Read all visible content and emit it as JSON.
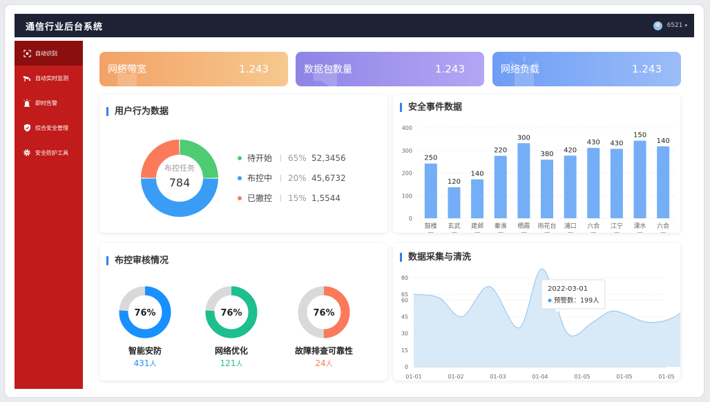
{
  "app": {
    "title": "通信行业后台系统",
    "user": "6521"
  },
  "colors": {
    "topbar": "#1d2235",
    "sidebar": "#c11b1b",
    "sidebar_active": "#8b0f0f",
    "accent": "#2f80ed"
  },
  "sidebar": {
    "items": [
      {
        "label": "自动识别",
        "icon": "scan-icon",
        "active": true
      },
      {
        "label": "自动实时监测",
        "icon": "camera-icon",
        "active": false
      },
      {
        "label": "即时告警",
        "icon": "alarm-light-icon",
        "active": false
      },
      {
        "label": "综合安全管理",
        "icon": "shield-icon",
        "active": false
      },
      {
        "label": "安全防护工具",
        "icon": "gear-icon",
        "active": false
      }
    ]
  },
  "stats": [
    {
      "label": "网络带宽",
      "value": "1.243"
    },
    {
      "label": "数据包数量",
      "value": "1.243"
    },
    {
      "label": "网络负载",
      "value": "1.243"
    }
  ],
  "user_behavior": {
    "title": "用户行为数据",
    "center_label": "布控任务",
    "center_value": "784",
    "legend": [
      {
        "name": "待开始",
        "percent": "65%",
        "value": "52,3456",
        "color": "#4ecb73"
      },
      {
        "name": "布控中",
        "percent": "20%",
        "value": "45,6732",
        "color": "#3a9df5"
      },
      {
        "name": "已撤控",
        "percent": "15%",
        "value": "1,5544",
        "color": "#fb7a5a"
      }
    ]
  },
  "review": {
    "title": "布控审核情况",
    "gauges": [
      {
        "name": "智能安防",
        "percent_label": "76%",
        "percent": 0.76,
        "count": "431",
        "unit": "人",
        "color": "#1890ff"
      },
      {
        "name": "网络优化",
        "percent_label": "76%",
        "percent": 0.76,
        "count": "121",
        "unit": "人",
        "color": "#1dbf8f"
      },
      {
        "name": "故障排查可靠性",
        "percent_label": "76%",
        "percent": 0.5,
        "count": "24",
        "unit": "人",
        "color": "#fb7a5a"
      }
    ]
  },
  "chart_data": [
    {
      "type": "pie",
      "categories": [
        "待开始",
        "布控中",
        "已撤控"
      ],
      "values": [
        25,
        50,
        25
      ],
      "colors": [
        "#4ecb73",
        "#3a9df5",
        "#fb7a5a"
      ],
      "title": "用户行为数据"
    },
    {
      "type": "bar",
      "title": "安全事件数据",
      "categories": [
        [
          "鼓楼",
          "区"
        ],
        [
          "玄武",
          "区"
        ],
        [
          "建邺",
          "区"
        ],
        [
          "秦淮",
          "区"
        ],
        [
          "栖霞",
          "区"
        ],
        [
          "雨花台",
          "区"
        ],
        [
          "浦口",
          "区"
        ],
        [
          "六合",
          "区"
        ],
        [
          "江宁",
          "区"
        ],
        [
          "溧水",
          "区"
        ],
        [
          "六合",
          "区"
        ]
      ],
      "values": [
        250,
        120,
        140,
        220,
        300,
        380,
        420,
        430,
        430,
        150,
        140
      ],
      "heights": [
        242,
        137,
        172,
        276,
        332,
        259,
        277,
        311,
        307,
        343,
        318
      ],
      "ylim": [
        0,
        400
      ],
      "yticks": [
        "0",
        "100",
        "200",
        "300",
        "400"
      ],
      "color": "#74aef7",
      "grid": true
    },
    {
      "type": "area",
      "title": "数据采集与清洗",
      "xticks": [
        "01-01",
        "01-02",
        "01-03",
        "01-04",
        "01-05",
        "01-05",
        "01-05"
      ],
      "x": [
        0,
        0.6,
        1.15,
        1.8,
        2.5,
        3.05,
        3.65,
        4.25,
        4.75,
        5.55,
        6.2,
        6.7
      ],
      "values": [
        65,
        62,
        45,
        72,
        35,
        88,
        30,
        40,
        50,
        40,
        45,
        63
      ],
      "ylim": [
        0,
        80
      ],
      "yticks": [
        "0",
        "15",
        "30",
        "45",
        "60",
        "65",
        "80"
      ],
      "color": "#9ec9ef",
      "grid": true,
      "tooltip": {
        "date": "2022-03-01",
        "label": "预警数：",
        "value": "199",
        "unit": "人"
      }
    }
  ]
}
